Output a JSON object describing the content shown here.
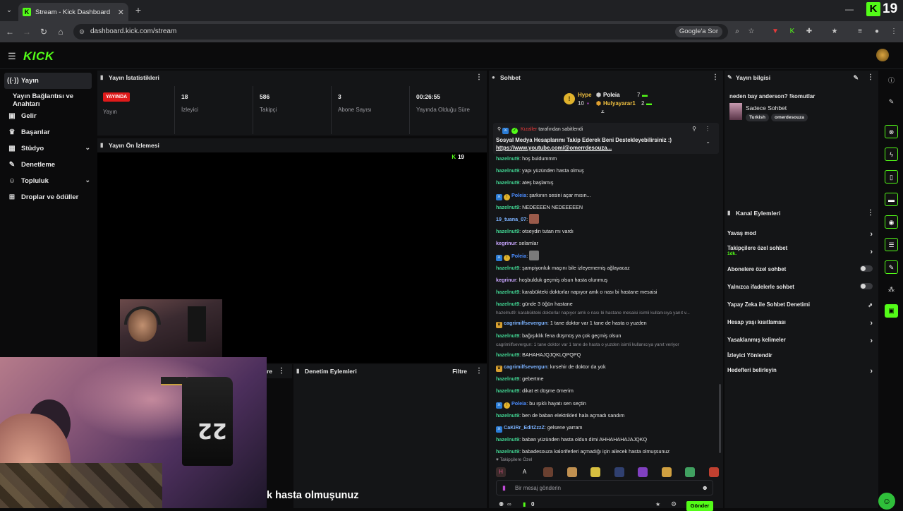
{
  "browser": {
    "tab_title": "Stream - Kick Dashboard",
    "url": "dashboard.kick.com/stream",
    "google_btn": "Google'a Sor",
    "kick_count": "19"
  },
  "topbar": {
    "logo": "KICK"
  },
  "sidebar": {
    "items": [
      {
        "label": "Yayın",
        "icon": "broadcast-icon"
      },
      {
        "label": "Yayın Bağlantısı ve Anahtarı",
        "icon": ""
      },
      {
        "label": "Gelir",
        "icon": "wallet-icon"
      },
      {
        "label": "Başarılar",
        "icon": "trophy-icon"
      },
      {
        "label": "Stüdyo",
        "icon": "grid-icon"
      },
      {
        "label": "Denetleme",
        "icon": "wrench-icon"
      },
      {
        "label": "Topluluk",
        "icon": "people-icon"
      },
      {
        "label": "Droplar ve ödüller",
        "icon": "gift-icon"
      }
    ]
  },
  "stats": {
    "title": "Yayın İstatistikleri",
    "live_badge": "YAYINDA",
    "items": [
      {
        "value": "",
        "label": "Yayın"
      },
      {
        "value": "18",
        "label": "İzleyici"
      },
      {
        "value": "586",
        "label": "Takipçi"
      },
      {
        "value": "3",
        "label": "Abone Sayısı"
      },
      {
        "value": "00:26:55",
        "label": "Yayında Olduğu Süre"
      }
    ]
  },
  "preview": {
    "title": "Yayın Ön İzlemesi",
    "viewers": "19",
    "overlay_text": "k hasta olmuşunuz"
  },
  "mod_actions": {
    "title": "Denetim Eylemleri",
    "filter": "Filtre",
    "left_fragment": "re"
  },
  "chat": {
    "title": "Sohbet",
    "hype_label": "Hype",
    "hype_level": "10",
    "hype_users": [
      {
        "name": "Poleia",
        "count": "7"
      },
      {
        "name": "Hulyayarar1",
        "count": "2"
      }
    ],
    "pinned": {
      "by_user": "Kızaller",
      "by_text": "tarafından sabitlendi",
      "message": "Sosyal Medya Hesaplarımı Takip Ederek Beni Destekleyebilirsiniz :)",
      "link": "https://www.youtube.com/@omerrdesouza..."
    },
    "messages": [
      {
        "user": "hazelnut9",
        "text": "hoş buldummm",
        "color": "#41d291"
      },
      {
        "user": "hazelnut9",
        "text": "yapı yüzünden hasta olmuş",
        "color": "#41d291"
      },
      {
        "user": "hazelnut9",
        "text": "ateş başlamış",
        "color": "#41d291"
      },
      {
        "user": "Poleia",
        "text": "şarkının sesini açar mısın...",
        "color": "#4a8cff",
        "badges": true
      },
      {
        "user": "hazelnut9",
        "text": "NEDEEEEN NEDEEEEEN",
        "color": "#41d291"
      },
      {
        "user": "19_tuana_07",
        "text": "",
        "color": "#7bb2ff",
        "emote": "#9a5a4a"
      },
      {
        "user": "hazelnut9",
        "text": "otseydin tutan mı vardı",
        "color": "#41d291"
      },
      {
        "user": "kegrinur",
        "text": "selamlar",
        "color": "#c9a6ff"
      },
      {
        "user": "Poleia",
        "text": "",
        "color": "#4a8cff",
        "badges": true,
        "emote": "#7a7a7a"
      },
      {
        "user": "hazelnut9",
        "text": "şampiyonluk maçını bile izleyememiş ağlayacaz",
        "color": "#41d291"
      },
      {
        "user": "kegrinur",
        "text": "hoşbulduk geçmiş olsun hasta olunmuş",
        "color": "#c9a6ff"
      },
      {
        "user": "hazelnut9",
        "text": "karabükteki doktorlar napıyor amk o nası bi hastane mesaisi",
        "color": "#41d291"
      },
      {
        "user": "hazelnut9",
        "text": "günde 3 öğün hastane",
        "color": "#41d291"
      },
      {
        "reply": "hazelnut9: karabükteki doktorlar napıyor amk o nası bi hastane mesaisi isimli kullanıcıya yanıt v..."
      },
      {
        "user": "cagrimilfsevergun",
        "text": "1 tane doktor var 1 tane de hasta o yuzden",
        "color": "#7bb2ff",
        "crown": true
      },
      {
        "user": "hazelnut9",
        "text": "bağışıklık fena düşmüş ya çok geçmiş olsun",
        "color": "#41d291"
      },
      {
        "reply": "cagrimilfsevergun: 1 tane doktor var 1 tane de hasta o yuzden isimli kullanıcıya yanıt veriyor"
      },
      {
        "user": "hazelnut9",
        "text": "BAHAHAJQJQKLQPQPQ",
        "color": "#41d291"
      },
      {
        "user": "cagrimilfsevergun",
        "text": "kırsehir de doktor da yok",
        "color": "#7bb2ff",
        "crown": true
      },
      {
        "user": "hazelnut9",
        "text": "gebertme",
        "color": "#41d291"
      },
      {
        "user": "hazelnut9",
        "text": "dikat et düşme ömerim",
        "color": "#41d291"
      },
      {
        "user": "Poleia",
        "text": "bu ışıklı hayatı sen seçtin",
        "color": "#4a8cff",
        "badges": true
      },
      {
        "user": "hazelnut9",
        "text": "ben de baban elektrikleri hala açmadı sandım",
        "color": "#41d291"
      },
      {
        "user": "CaKiRr_EditZzzZ",
        "text": "gelsene yarram",
        "color": "#7bb2ff",
        "kickbadge": true
      },
      {
        "user": "hazelnut9",
        "text": "baban yüzünden hasta oldun dimi AHHAHAHAJAJQKQ",
        "color": "#41d291"
      },
      {
        "user": "hazelnut9",
        "text": "babadesouza kaloriferleri açmadığı için ailecek hasta olmuşsunuz",
        "color": "#41d291"
      }
    ],
    "followers_only": "Takipçilere Özel",
    "input_placeholder": "Bir mesaj gönderin",
    "coins": "0",
    "send": "Gönder"
  },
  "stream_info": {
    "title": "Yayın bilgisi",
    "stream_title": "neden bay anderson? !komutlar",
    "category": "Sadece Sohbet",
    "tags": [
      "Turkish",
      "omerdesouza"
    ]
  },
  "channel_actions": {
    "title": "Kanal Eylemleri",
    "items": [
      {
        "label": "Yavaş mod",
        "control": "arrow"
      },
      {
        "label": "Takipçilere özel sohbet",
        "sub": "1dk.",
        "control": "arrow"
      },
      {
        "label": "Abonelere özel sohbet",
        "control": "toggle"
      },
      {
        "label": "Yalnızca ifadelerle sohbet",
        "control": "toggle"
      },
      {
        "label": "Yapay Zeka ile Sohbet Denetimi",
        "control": "external"
      },
      {
        "label": "Hesap yaşı kısıtlaması",
        "control": "arrow"
      },
      {
        "label": "Yasaklanmış kelimeler",
        "control": "arrow"
      },
      {
        "label": "İzleyici Yönlendir",
        "control": "none"
      },
      {
        "label": "Hedefleri belirleyin",
        "control": "arrow"
      }
    ]
  },
  "colors": {
    "accent": "#53fc18",
    "live": "#e01a1a",
    "panel": "#141517",
    "bg": "#0b0b0c"
  }
}
